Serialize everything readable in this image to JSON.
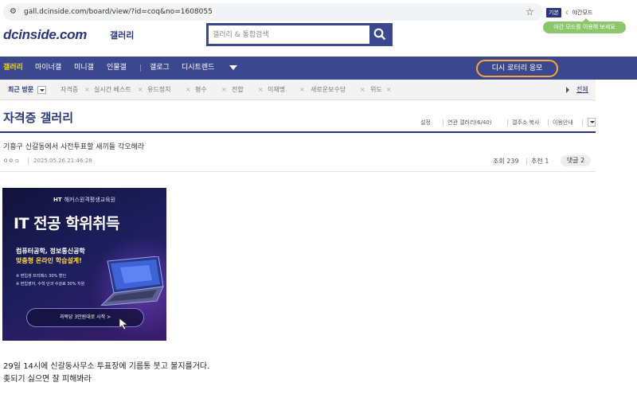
{
  "browser": {
    "url": "gall.dcinside.com/board/view/?id=coq&no=1608055",
    "theme_label": "기본",
    "dark_mode_label": "야간모드",
    "dark_mode_tooltip": "야간 모드를 이용해 보세요"
  },
  "site": {
    "logo": "dcinside.com",
    "logo_sub": "갤러리",
    "search_placeholder": "갤러리 & 통합검색"
  },
  "nav": {
    "items": [
      "갤러리",
      "마이너갤",
      "미니갤",
      "인물갤",
      "갤로그",
      "디시트렌드"
    ],
    "cta": "디시 로터리 응모"
  },
  "recent": {
    "label": "최근 방문",
    "items": [
      "자격증",
      "실시간 베스트",
      "유드정치",
      "평수",
      "전합",
      "이재명",
      "새로운보수당",
      "위도"
    ],
    "all": "전체"
  },
  "gallery": {
    "title": "자격증 갤러리",
    "tools": [
      "설정",
      "연관 갤러리(6/40)",
      "갤주소 복사",
      "이용안내"
    ]
  },
  "post": {
    "title": "기흥구 신갈동에서 사전투표할 새끼들 각오해라",
    "author": "ㅇㅇ",
    "date": "2025.05.26 21:46:28",
    "views_label": "조회 239",
    "recommend_label": "추천 1",
    "comments_label": "댓글 2",
    "body": [
      "29일 14시에 신갈동사무소 투표장에 기름통 붓고 불지를거다.",
      "좆되기 싫으면 잘 피해봐라"
    ]
  },
  "ad": {
    "brand": "해커스원격평생교육원",
    "brand_mark": "HT",
    "headline": "IT 전공 학위취득",
    "line1": "컴퓨터공학, 정보통신공학",
    "line2": "맞춤형 온라인 학습설계!",
    "bullet1": "※ 편입생 프리패스 30% 할인",
    "bullet2": "※ 편입영어, 수학 단과 수강료 30% 지원",
    "cta": "과목당 3만원대로 시작 >"
  },
  "colors": {
    "brand": "#3b4890",
    "accent": "#ffd600",
    "cta_border": "#f6a93a",
    "tooltip": "#8cc66d"
  }
}
